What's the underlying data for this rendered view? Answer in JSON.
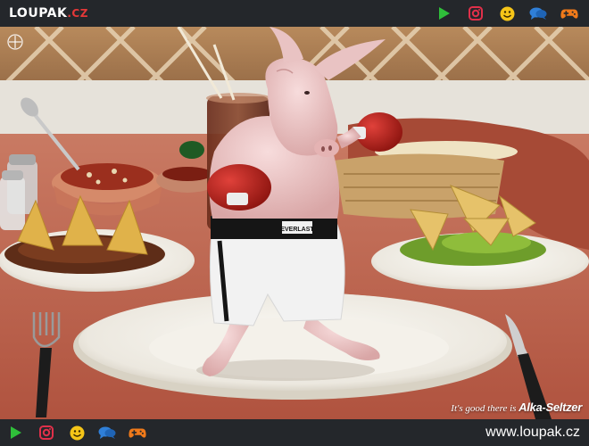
{
  "header": {
    "logo_main": "LOUPAK",
    "logo_tld": ".CZ",
    "icons": [
      "play-icon",
      "instagram-icon",
      "smiley-icon",
      "chat-bubbles-icon",
      "gamepad-icon"
    ]
  },
  "photo": {
    "slogan": "It's good there is",
    "brand": "Alka-Seltzer",
    "shorts_label": "EVERLAST"
  },
  "footer": {
    "icons": [
      "play-icon",
      "instagram-icon",
      "smiley-icon",
      "chat-bubbles-icon",
      "gamepad-icon"
    ],
    "site_url": "www.loupak.cz"
  },
  "colors": {
    "bar_bg": "#24272b",
    "logo_red": "#e43838",
    "play_green": "#2fbf3a",
    "instagram_red": "#e0304a",
    "smiley_yellow": "#f5c518",
    "chat_blue": "#2f7fd8",
    "gamepad_orange": "#f07a1a",
    "tablecloth": "#c56a54"
  }
}
